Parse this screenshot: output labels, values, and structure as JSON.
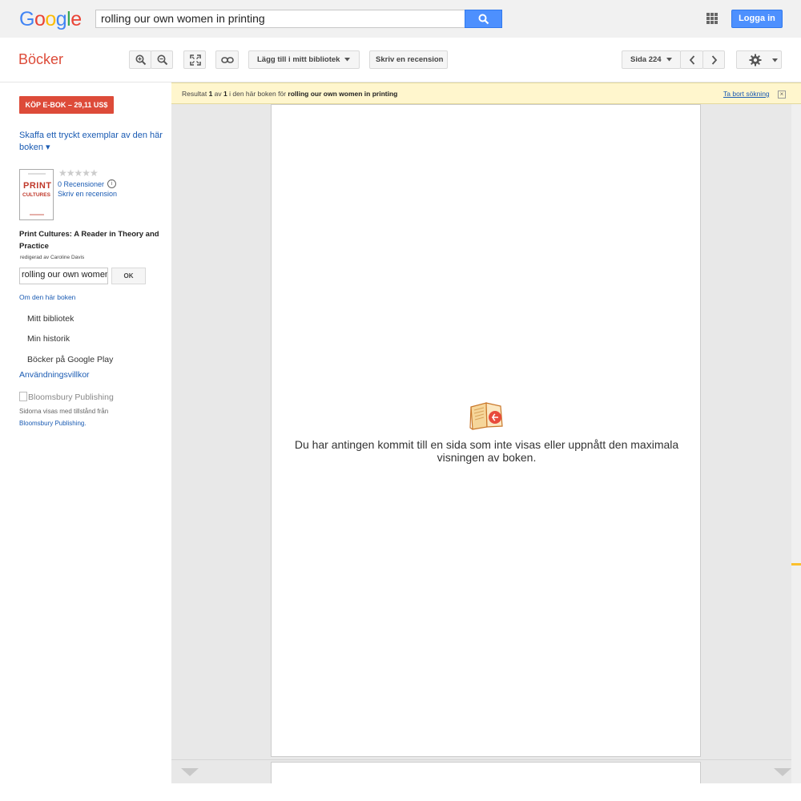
{
  "header": {
    "logo_letters": [
      {
        "ch": "G",
        "color": "#4285f4"
      },
      {
        "ch": "o",
        "color": "#ea4335"
      },
      {
        "ch": "o",
        "color": "#fbbc05"
      },
      {
        "ch": "g",
        "color": "#4285f4"
      },
      {
        "ch": "l",
        "color": "#34a853"
      },
      {
        "ch": "e",
        "color": "#ea4335"
      }
    ],
    "search_value": "rolling our own women in printing",
    "search_icon": "magnifier-icon",
    "apps_icon": "apps-grid-icon",
    "login_label": "Logga in"
  },
  "toolbar": {
    "section_title": "Böcker",
    "zoom_in_icon": "zoom-in-icon",
    "zoom_out_icon": "zoom-out-icon",
    "fullscreen_icon": "fullscreen-icon",
    "link_icon": "link-icon",
    "add_to_library_label": "Lägg till i mitt bibliotek",
    "write_review_label": "Skriv en recension",
    "page_label": "Sida 224",
    "prev_icon": "chevron-left-icon",
    "next_icon": "chevron-right-icon",
    "settings_icon": "gear-icon"
  },
  "sidebar": {
    "buy_label": "KÖP E-BOK – 29,11 US$",
    "print_copy_label": "Skaffa ett tryckt exemplar av den här boken ▾",
    "cover_title_1": "PRINT",
    "cover_title_2": "CULTURES",
    "stars": "★★★★★",
    "reviews_label": "0 Recensioner",
    "info_icon_glyph": "i",
    "write_review_label": "Skriv en recension",
    "book_title": "Print Cultures: A Reader in Theory and Practice",
    "book_editor": "redigerad av Caroline Davis",
    "inbook_search_value": "rolling our own women in printing",
    "ok_label": "OK",
    "about_label": "Om den här boken",
    "links": [
      "Mitt bibliotek",
      "Min historik",
      "Böcker på Google Play"
    ],
    "terms_label": "Användningsvillkor",
    "publisher_img_alt": "Bloomsbury Publishing",
    "pages_shown_label": "Sidorna visas med tillstånd från",
    "publisher_link": "Bloomsbury Publishing",
    "publisher_link_suffix": "."
  },
  "viewer": {
    "result_prefix": "Resultat",
    "result_current": "1",
    "result_of": "av",
    "result_total": "1",
    "result_middle": "i den här boken för",
    "result_query": "rolling our own women in printing",
    "clear_search_label": "Ta bort sökning",
    "clear_icon": "close-icon",
    "notice": "Du har antingen kommit till en sida som inte visas eller uppnått den maximala visningen av boken.",
    "book_icon": "open-book-icon"
  },
  "colors": {
    "brand_blue": "#4d90fe",
    "books_red": "#dd4b39",
    "link_blue": "#1a5bb3",
    "result_bar": "#fff6cd",
    "scroll_marker": "#fbc02d"
  }
}
